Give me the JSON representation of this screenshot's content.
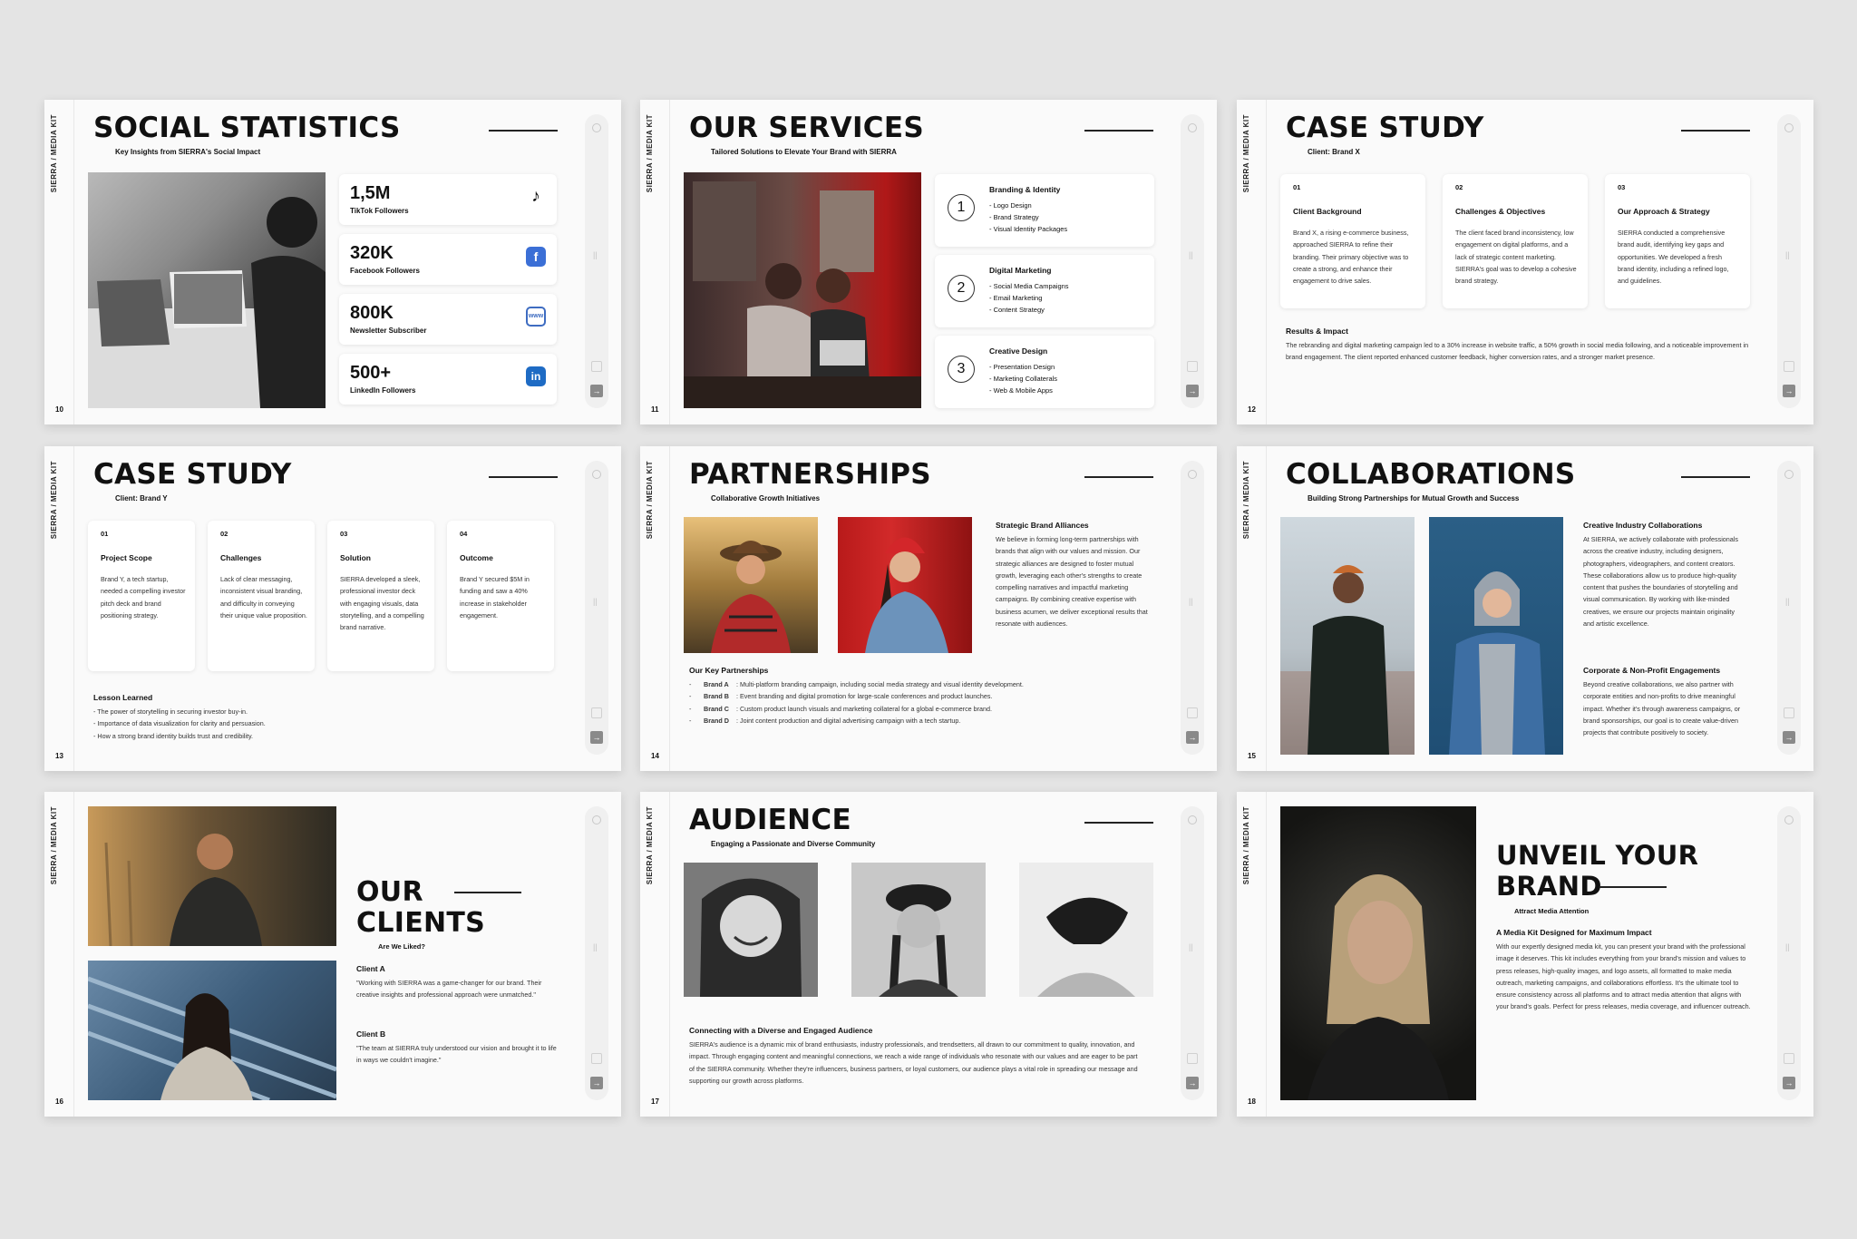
{
  "brand": "SIERRA / MEDIA KIT",
  "s10": {
    "num": "10",
    "title": "SOCIAL STATISTICS",
    "subtitle": "Key Insights from SIERRA's Social Impact",
    "stats": [
      {
        "value": "1,5M",
        "label": "TikTok Followers",
        "icon": "tiktok-icon"
      },
      {
        "value": "320K",
        "label": "Facebook Followers",
        "icon": "facebook-icon"
      },
      {
        "value": "800K",
        "label": "Newsletter Subscriber",
        "icon": "www-icon"
      },
      {
        "value": "500+",
        "label": "LinkedIn Followers",
        "icon": "linkedin-icon"
      }
    ],
    "icon_colors": {
      "facebook": "#3b6fd6",
      "linkedin": "#1e6bc4",
      "www": "#3e6cc1",
      "tiktok": "#000000"
    }
  },
  "s11": {
    "num": "11",
    "title": "OUR SERVICES",
    "subtitle": "Tailored Solutions to Elevate Your Brand with SIERRA",
    "services": [
      {
        "n": "1",
        "title": "Branding & Identity",
        "items": [
          "Logo Design",
          "Brand Strategy",
          "Visual Identity Packages"
        ]
      },
      {
        "n": "2",
        "title": "Digital Marketing",
        "items": [
          "Social Media Campaigns",
          "Email Marketing",
          "Content Strategy"
        ]
      },
      {
        "n": "3",
        "title": "Creative Design",
        "items": [
          "Presentation Design",
          "Marketing Collaterals",
          "Web & Mobile Apps"
        ]
      }
    ]
  },
  "s12": {
    "num": "12",
    "title": "CASE STUDY",
    "subtitle": "Client: Brand X",
    "cols": [
      {
        "n": "01",
        "title": "Client Background",
        "body": "Brand X, a rising e-commerce business, approached SIERRA to refine their branding. Their primary objective was to create a strong, and enhance their engagement to drive sales."
      },
      {
        "n": "02",
        "title": "Challenges & Objectives",
        "body": "The client faced brand inconsistency, low engagement on digital platforms, and a lack of strategic content marketing. SIERRA's goal was to develop a cohesive brand strategy."
      },
      {
        "n": "03",
        "title": "Our Approach & Strategy",
        "body": "SIERRA conducted a comprehensive brand audit, identifying key gaps and opportunities. We developed a fresh brand identity, including a refined logo, and guidelines."
      }
    ],
    "results_title": "Results & Impact",
    "results_body": "The rebranding and digital marketing campaign led to a 30% increase in website traffic, a 50% growth in social media following, and a noticeable improvement in brand engagement. The client reported enhanced customer feedback, higher conversion rates, and a stronger market presence."
  },
  "s13": {
    "num": "13",
    "title": "CASE STUDY",
    "subtitle": "Client: Brand Y",
    "cols": [
      {
        "n": "01",
        "title": "Project Scope",
        "body": "Brand Y, a tech startup, needed a compelling investor pitch deck and brand positioning strategy."
      },
      {
        "n": "02",
        "title": "Challenges",
        "body": "Lack of clear messaging, inconsistent visual branding, and difficulty in conveying their unique value proposition."
      },
      {
        "n": "03",
        "title": "Solution",
        "body": "SIERRA developed a sleek, professional investor deck with engaging visuals, data storytelling, and a compelling brand narrative."
      },
      {
        "n": "04",
        "title": "Outcome",
        "body": "Brand Y secured $5M in funding and saw a 40% increase in stakeholder engagement."
      }
    ],
    "lesson_title": "Lesson Learned",
    "lessons": [
      "The power of storytelling in securing investor buy-in.",
      "Importance of data visualization for clarity and persuasion.",
      "How a strong brand identity builds trust and credibility."
    ]
  },
  "s14": {
    "num": "14",
    "title": "PARTNERSHIPS",
    "subtitle": "Collaborative Growth Initiatives",
    "alliance_title": "Strategic Brand Alliances",
    "alliance_body": "We believe in forming long-term partnerships with brands that align with our values and mission. Our strategic alliances are designed to foster mutual growth, leveraging each other's strengths to create compelling narratives and impactful marketing campaigns. By combining creative expertise with business acumen, we deliver exceptional results that resonate with audiences.",
    "key_title": "Our Key Partnerships",
    "partners": [
      {
        "name": "Brand A",
        "desc": ": Multi-platform branding campaign, including social media strategy and visual identity development."
      },
      {
        "name": "Brand B",
        "desc": ": Event branding and digital promotion for large-scale conferences and product launches."
      },
      {
        "name": "Brand C",
        "desc": ": Custom product launch visuals and marketing collateral for a global e-commerce brand."
      },
      {
        "name": "Brand D",
        "desc": ": Joint content production and digital advertising campaign with a tech startup."
      }
    ]
  },
  "s15": {
    "num": "15",
    "title": "COLLABORATIONS",
    "subtitle": "Building Strong Partnerships for Mutual Growth and Success",
    "h1": "Creative Industry Collaborations",
    "b1": "At SIERRA, we actively collaborate with professionals across the creative industry, including designers, photographers, videographers, and content creators. These collaborations allow us to produce high-quality content that pushes the boundaries of storytelling and visual communication. By working with like-minded creatives, we ensure our projects maintain originality and artistic excellence.",
    "h2": "Corporate & Non-Profit Engagements",
    "b2": "Beyond creative collaborations, we also partner with corporate entities and non-profits to drive meaningful impact. Whether it's through awareness campaigns, or brand sponsorships, our goal is to create value-driven projects that contribute positively to society."
  },
  "s16": {
    "num": "16",
    "title1": "OUR",
    "title2": "CLIENTS",
    "subtitle": "Are We Liked?",
    "clients": [
      {
        "name": "Client A",
        "quote": "\"Working with SIERRA was a game-changer for our brand. Their creative insights and professional approach were unmatched.\""
      },
      {
        "name": "Client B",
        "quote": "\"The team at SIERRA truly understood our vision and brought it to life in ways we couldn't imagine.\""
      }
    ]
  },
  "s17": {
    "num": "17",
    "title": "AUDIENCE",
    "subtitle": "Engaging a Passionate and Diverse Community",
    "h": "Connecting with a Diverse and Engaged Audience",
    "body": "SIERRA's audience is a dynamic mix of brand enthusiasts, industry professionals, and trendsetters, all drawn to our commitment to quality, innovation, and impact. Through engaging content and meaningful connections, we reach a wide range of individuals who resonate with our values and are eager to be part of the SIERRA community. Whether they're influencers, business partners, or loyal customers, our audience plays a vital role in spreading our message and supporting our growth across platforms."
  },
  "s18": {
    "num": "18",
    "title1": "UNVEIL YOUR",
    "title2": "BRAND",
    "subtitle": "Attract Media Attention",
    "h": "A Media Kit Designed for Maximum Impact",
    "body": "With our expertly designed media kit, you can present your brand with the professional image it deserves. This kit includes everything from your brand's mission and values to press releases, high-quality images, and logo assets, all formatted to make media outreach, marketing campaigns, and collaborations effortless. It's the ultimate tool to ensure consistency across all platforms and to attract media attention that aligns with your brand's goals. Perfect for press releases, media coverage, and influencer outreach."
  }
}
